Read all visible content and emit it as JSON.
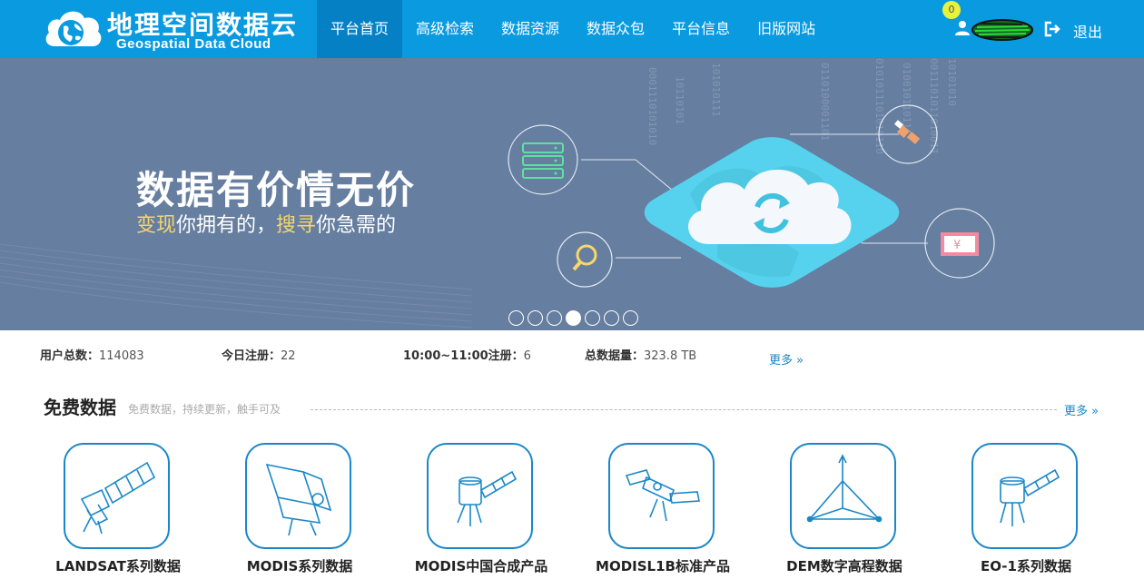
{
  "header": {
    "logo": {
      "title_cn": "地理空间数据云",
      "title_en": "Geospatial Data Cloud",
      "icon": "globe-cloud-logo"
    },
    "nav": [
      {
        "label": "平台首页",
        "active": true
      },
      {
        "label": "高级检索",
        "active": false
      },
      {
        "label": "数据资源",
        "active": false
      },
      {
        "label": "数据众包",
        "active": false
      },
      {
        "label": "平台信息",
        "active": false
      },
      {
        "label": "旧版网站",
        "active": false
      }
    ],
    "user": {
      "notification_count": "0",
      "user_icon": "user-icon",
      "logout_icon": "logout-icon",
      "logout_label": "退出"
    },
    "colors": {
      "bar": "#0a9ae0",
      "active_tab": "#0680c4"
    }
  },
  "banner": {
    "title": "数据有价情无价",
    "subtitle": {
      "hl1": "变现",
      "part1": "你拥有的，",
      "hl2": "搜寻",
      "part2": "你急需的"
    },
    "slide_count": 7,
    "active_slide": 4,
    "icons": [
      "server-icon",
      "cloud-sync-icon",
      "satellite-icon",
      "search-icon",
      "money-icon"
    ],
    "colors": {
      "background": "#667e9f",
      "highlight": "#f6d76b",
      "platform": "#56d2ee"
    }
  },
  "stats": {
    "users_label": "用户总数：",
    "users_value": "114083",
    "today_label": "今日注册：",
    "today_value": "22",
    "hour_label": "10:00~11:00注册：",
    "hour_value": "6",
    "total_label": "总数据量：",
    "total_value": "323.8 TB",
    "more_label": "更多"
  },
  "free_data": {
    "title": "免费数据",
    "subtitle": "免费数据，持续更新，触手可及",
    "more_label": "更多",
    "items": [
      {
        "label": "LANDSAT系列数据",
        "icon": "landsat-satellite-icon"
      },
      {
        "label": "MODIS系列数据",
        "icon": "modis-sensor-icon"
      },
      {
        "label": "MODIS中国合成产品",
        "icon": "modis-satellite-icon"
      },
      {
        "label": "MODISL1B标准产品",
        "icon": "modis-l1b-satellite-icon"
      },
      {
        "label": "DEM数字高程数据",
        "icon": "dem-elevation-icon"
      },
      {
        "label": "EO-1系列数据",
        "icon": "eo1-satellite-icon"
      }
    ],
    "colors": {
      "icon_stroke": "#1a87c8"
    }
  }
}
